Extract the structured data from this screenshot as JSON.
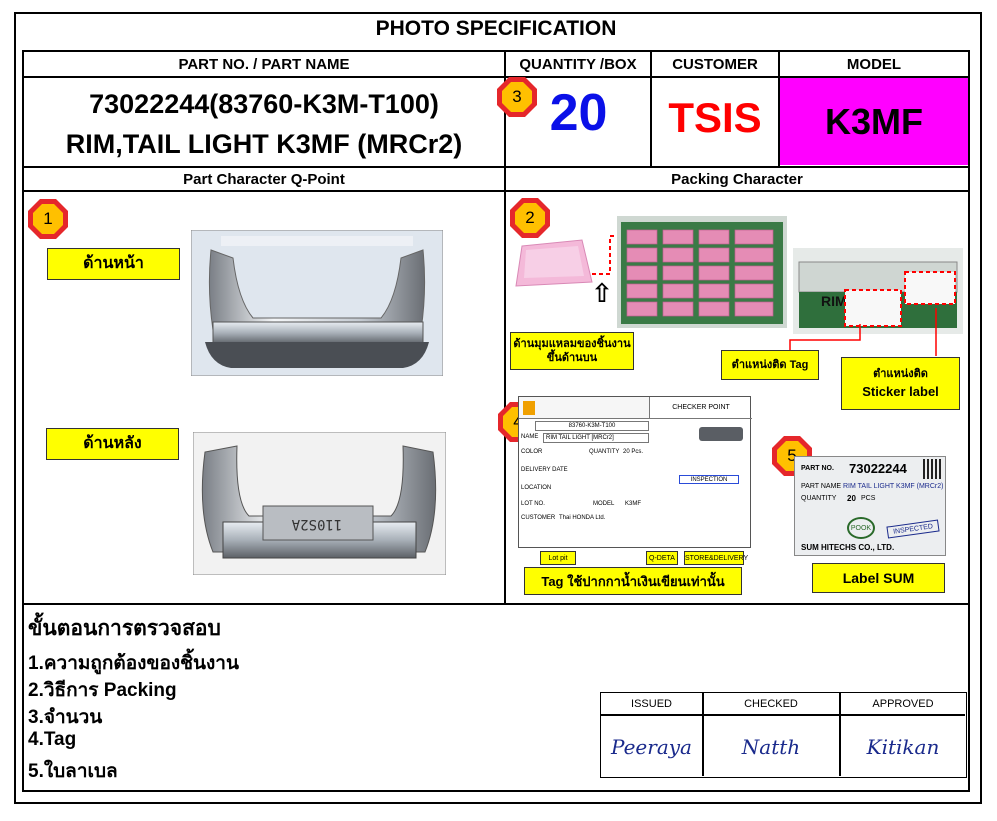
{
  "title": "PHOTO  SPECIFICATION",
  "headers": {
    "part": "PART NO. / PART NAME",
    "quantity": "QUANTITY /BOX",
    "customer": "CUSTOMER",
    "model": "MODEL"
  },
  "part_no": "73022244(83760-K3M-T100)",
  "part_name": "RIM,TAIL LIGHT K3MF (MRCr2)",
  "quantity": "20",
  "customer": "TSIS",
  "model": "K3MF",
  "sections": {
    "left": "Part Character Q-Point",
    "right": "Packing Character"
  },
  "markers": [
    "1",
    "2",
    "3",
    "4",
    "5"
  ],
  "labels": {
    "front": "ด้านหน้า",
    "back": "ด้านหลัง",
    "corner": "ด้านมุมแหลมของชิ้นงาน ขึ้นด้านบน",
    "tag_position": "ตำแหน่งติด Tag",
    "sticker_pos": "ตำแหน่งติด",
    "sticker_label": "Sticker label",
    "tag_note": "Tag ใช้ปากกาน้ำเงินเขียนเท่านั้น",
    "label_sum": "Label SUM"
  },
  "tag_card": {
    "checker": "CHECKER POINT",
    "part_no": "83760-K3M-T100",
    "name": "RIM TAIL LIGHT [MRCr2]",
    "name_label": "NAME",
    "color": "COLOR",
    "quantity_label": "QUANTITY",
    "quantity": "20 Pcs.",
    "delivery": "DELIVERY DATE",
    "location": "LOCATION",
    "lot": "LOT NO.",
    "model_label": "MODEL",
    "model": "K3MF",
    "customer_label": "CUSTOMER",
    "customer": "Thai HONDA Ltd.",
    "inspection": "INSPECTION",
    "lot_pit": "Lot pit",
    "q_deta": "Q-DETA",
    "store": "STORE&DELIVERY"
  },
  "sum_label": {
    "part_no_label": "PART NO.",
    "part_no": "73022244",
    "part_name_label": "PART NAME",
    "part_name": "RIM TAIL LIGHT K3MF (MRCr2)",
    "quantity_label": "QUANTITY",
    "quantity": "20",
    "pcs": "PCS",
    "footer": "SUM HITECHS CO., LTD.",
    "stamp": "POOK",
    "inspected": "INSPECTED"
  },
  "steps_title": "ขั้นตอนการตรวจสอบ",
  "steps": [
    "1.ความถูกต้องของชิ้นงาน",
    "2.วิธีการ Packing",
    "3.จำนวน",
    "4.Tag",
    "5.ใบลาเบล"
  ],
  "signoff": {
    "headers": [
      "ISSUED",
      "CHECKED",
      "APPROVED"
    ],
    "signatures": [
      "Peeraya",
      "Natth",
      "Kitikan"
    ]
  },
  "colors": {
    "quantity": "#0a10e8",
    "customer": "#ff0000",
    "model_bg": "#ff00ff",
    "label_bg": "#ffff00",
    "marker_outer": "#e5272b",
    "marker_inner": "#ffc000"
  }
}
